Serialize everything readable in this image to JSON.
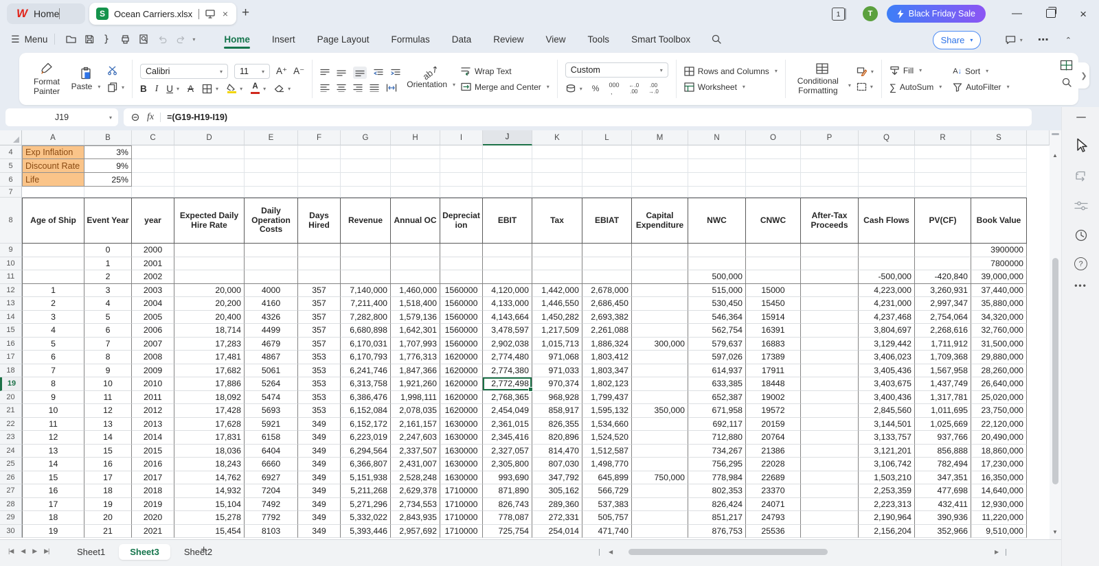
{
  "titlebar": {
    "home_tab": "Home",
    "doc_tab": "Ocean Carriers.xlsx",
    "window_count": "1",
    "avatar": "T",
    "promo": "Black Friday Sale"
  },
  "menubar": {
    "menu": "Menu",
    "tabs": [
      "Home",
      "Insert",
      "Page Layout",
      "Formulas",
      "Data",
      "Review",
      "View",
      "Tools",
      "Smart Toolbox"
    ],
    "active_tab": "Home",
    "share": "Share"
  },
  "ribbon": {
    "format_painter": "Format Painter",
    "paste": "Paste",
    "font_name": "Calibri",
    "font_size": "11",
    "wrap_text": "Wrap Text",
    "merge_center": "Merge and Center",
    "orientation": "Orientation",
    "number_format": "Custom",
    "rows_columns": "Rows and Columns",
    "worksheet": "Worksheet",
    "conditional_formatting": "Conditional Formatting",
    "fill": "Fill",
    "autosum": "AutoSum",
    "sort": "Sort",
    "autofilter": "AutoFilter"
  },
  "formula_bar": {
    "name_box": "J19",
    "fx": "fx",
    "formula": "=(G19-H19-I19)"
  },
  "grid": {
    "columns": [
      "A",
      "B",
      "C",
      "D",
      "E",
      "F",
      "G",
      "H",
      "I",
      "J",
      "K",
      "L",
      "M",
      "N",
      "O",
      "P",
      "Q",
      "R",
      "S"
    ],
    "selected_column": "J",
    "selected_row": "19",
    "selected_cell": "J19",
    "accent_green": "#1C7147",
    "rows": [
      {
        "n": "4",
        "cells": [
          "Exp Inflation",
          "3%",
          "",
          "",
          "",
          "",
          "",
          "",
          "",
          "",
          "",
          "",
          "",
          "",
          "",
          "",
          "",
          "",
          ""
        ]
      },
      {
        "n": "5",
        "cells": [
          "Discount Rate",
          "9%",
          "",
          "",
          "",
          "",
          "",
          "",
          "",
          "",
          "",
          "",
          "",
          "",
          "",
          "",
          "",
          "",
          ""
        ]
      },
      {
        "n": "6",
        "cells": [
          "Life",
          "25%",
          "",
          "",
          "",
          "",
          "",
          "",
          "",
          "",
          "",
          "",
          "",
          "",
          "",
          "",
          "",
          "",
          ""
        ]
      },
      {
        "n": "7",
        "cells": [
          "",
          "",
          "",
          "",
          "",
          "",
          "",
          "",
          "",
          "",
          "",
          "",
          "",
          "",
          "",
          "",
          "",
          "",
          ""
        ]
      },
      {
        "n": "8",
        "cells": [
          "Age of Ship",
          "Event Year",
          "year",
          "Expected Daily Hire Rate",
          "Daily Operation Costs",
          "Days Hired",
          "Revenue",
          "Annual OC",
          "Depreciation",
          "EBIT",
          "Tax",
          "EBIAT",
          "Capital Expenditure",
          "NWC",
          "CNWC",
          "After-Tax Proceeds",
          "Cash Flows",
          "PV(CF)",
          "Book Value"
        ]
      },
      {
        "n": "9",
        "cells": [
          "",
          "0",
          "2000",
          "",
          "",
          "",
          "",
          "",
          "",
          "",
          "",
          "",
          "",
          "",
          "",
          "",
          "",
          "",
          "3900000"
        ]
      },
      {
        "n": "10",
        "cells": [
          "",
          "1",
          "2001",
          "",
          "",
          "",
          "",
          "",
          "",
          "",
          "",
          "",
          "",
          "",
          "",
          "",
          "",
          "",
          "7800000"
        ]
      },
      {
        "n": "11",
        "cells": [
          "",
          "2",
          "2002",
          "",
          "",
          "",
          "",
          "",
          "",
          "",
          "",
          "",
          "",
          "500,000",
          "",
          "",
          "-500,000",
          "-420,840",
          "39,000,000"
        ]
      },
      {
        "n": "12",
        "cells": [
          "1",
          "3",
          "2003",
          "20,000",
          "4000",
          "357",
          "7,140,000",
          "1,460,000",
          "1560000",
          "4,120,000",
          "1,442,000",
          "2,678,000",
          "",
          "515,000",
          "15000",
          "",
          "4,223,000",
          "3,260,931",
          "37,440,000"
        ]
      },
      {
        "n": "13",
        "cells": [
          "2",
          "4",
          "2004",
          "20,200",
          "4160",
          "357",
          "7,211,400",
          "1,518,400",
          "1560000",
          "4,133,000",
          "1,446,550",
          "2,686,450",
          "",
          "530,450",
          "15450",
          "",
          "4,231,000",
          "2,997,347",
          "35,880,000"
        ]
      },
      {
        "n": "14",
        "cells": [
          "3",
          "5",
          "2005",
          "20,400",
          "4326",
          "357",
          "7,282,800",
          "1,579,136",
          "1560000",
          "4,143,664",
          "1,450,282",
          "2,693,382",
          "",
          "546,364",
          "15914",
          "",
          "4,237,468",
          "2,754,064",
          "34,320,000"
        ]
      },
      {
        "n": "15",
        "cells": [
          "4",
          "6",
          "2006",
          "18,714",
          "4499",
          "357",
          "6,680,898",
          "1,642,301",
          "1560000",
          "3,478,597",
          "1,217,509",
          "2,261,088",
          "",
          "562,754",
          "16391",
          "",
          "3,804,697",
          "2,268,616",
          "32,760,000"
        ]
      },
      {
        "n": "16",
        "cells": [
          "5",
          "7",
          "2007",
          "17,283",
          "4679",
          "357",
          "6,170,031",
          "1,707,993",
          "1560000",
          "2,902,038",
          "1,015,713",
          "1,886,324",
          "300,000",
          "579,637",
          "16883",
          "",
          "3,129,442",
          "1,711,912",
          "31,500,000"
        ]
      },
      {
        "n": "17",
        "cells": [
          "6",
          "8",
          "2008",
          "17,481",
          "4867",
          "353",
          "6,170,793",
          "1,776,313",
          "1620000",
          "2,774,480",
          "971,068",
          "1,803,412",
          "",
          "597,026",
          "17389",
          "",
          "3,406,023",
          "1,709,368",
          "29,880,000"
        ]
      },
      {
        "n": "18",
        "cells": [
          "7",
          "9",
          "2009",
          "17,682",
          "5061",
          "353",
          "6,241,746",
          "1,847,366",
          "1620000",
          "2,774,380",
          "971,033",
          "1,803,347",
          "",
          "614,937",
          "17911",
          "",
          "3,405,436",
          "1,567,958",
          "28,260,000"
        ]
      },
      {
        "n": "19",
        "cells": [
          "8",
          "10",
          "2010",
          "17,886",
          "5264",
          "353",
          "6,313,758",
          "1,921,260",
          "1620000",
          "2,772,498",
          "970,374",
          "1,802,123",
          "",
          "633,385",
          "18448",
          "",
          "3,403,675",
          "1,437,749",
          "26,640,000"
        ]
      },
      {
        "n": "20",
        "cells": [
          "9",
          "11",
          "2011",
          "18,092",
          "5474",
          "353",
          "6,386,476",
          "1,998,111",
          "1620000",
          "2,768,365",
          "968,928",
          "1,799,437",
          "",
          "652,387",
          "19002",
          "",
          "3,400,436",
          "1,317,781",
          "25,020,000"
        ]
      },
      {
        "n": "21",
        "cells": [
          "10",
          "12",
          "2012",
          "17,428",
          "5693",
          "353",
          "6,152,084",
          "2,078,035",
          "1620000",
          "2,454,049",
          "858,917",
          "1,595,132",
          "350,000",
          "671,958",
          "19572",
          "",
          "2,845,560",
          "1,011,695",
          "23,750,000"
        ]
      },
      {
        "n": "22",
        "cells": [
          "11",
          "13",
          "2013",
          "17,628",
          "5921",
          "349",
          "6,152,172",
          "2,161,157",
          "1630000",
          "2,361,015",
          "826,355",
          "1,534,660",
          "",
          "692,117",
          "20159",
          "",
          "3,144,501",
          "1,025,669",
          "22,120,000"
        ]
      },
      {
        "n": "23",
        "cells": [
          "12",
          "14",
          "2014",
          "17,831",
          "6158",
          "349",
          "6,223,019",
          "2,247,603",
          "1630000",
          "2,345,416",
          "820,896",
          "1,524,520",
          "",
          "712,880",
          "20764",
          "",
          "3,133,757",
          "937,766",
          "20,490,000"
        ]
      },
      {
        "n": "24",
        "cells": [
          "13",
          "15",
          "2015",
          "18,036",
          "6404",
          "349",
          "6,294,564",
          "2,337,507",
          "1630000",
          "2,327,057",
          "814,470",
          "1,512,587",
          "",
          "734,267",
          "21386",
          "",
          "3,121,201",
          "856,888",
          "18,860,000"
        ]
      },
      {
        "n": "25",
        "cells": [
          "14",
          "16",
          "2016",
          "18,243",
          "6660",
          "349",
          "6,366,807",
          "2,431,007",
          "1630000",
          "2,305,800",
          "807,030",
          "1,498,770",
          "",
          "756,295",
          "22028",
          "",
          "3,106,742",
          "782,494",
          "17,230,000"
        ]
      },
      {
        "n": "26",
        "cells": [
          "15",
          "17",
          "2017",
          "14,762",
          "6927",
          "349",
          "5,151,938",
          "2,528,248",
          "1630000",
          "993,690",
          "347,792",
          "645,899",
          "750,000",
          "778,984",
          "22689",
          "",
          "1,503,210",
          "347,351",
          "16,350,000"
        ]
      },
      {
        "n": "27",
        "cells": [
          "16",
          "18",
          "2018",
          "14,932",
          "7204",
          "349",
          "5,211,268",
          "2,629,378",
          "1710000",
          "871,890",
          "305,162",
          "566,729",
          "",
          "802,353",
          "23370",
          "",
          "2,253,359",
          "477,698",
          "14,640,000"
        ]
      },
      {
        "n": "28",
        "cells": [
          "17",
          "19",
          "2019",
          "15,104",
          "7492",
          "349",
          "5,271,296",
          "2,734,553",
          "1710000",
          "826,743",
          "289,360",
          "537,383",
          "",
          "826,424",
          "24071",
          "",
          "2,223,313",
          "432,411",
          "12,930,000"
        ]
      },
      {
        "n": "29",
        "cells": [
          "18",
          "20",
          "2020",
          "15,278",
          "7792",
          "349",
          "5,332,022",
          "2,843,935",
          "1710000",
          "778,087",
          "272,331",
          "505,757",
          "",
          "851,217",
          "24793",
          "",
          "2,190,964",
          "390,936",
          "11,220,000"
        ]
      },
      {
        "n": "30",
        "cells": [
          "19",
          "21",
          "2021",
          "15,454",
          "8103",
          "349",
          "5,393,446",
          "2,957,692",
          "1710000",
          "725,754",
          "254,014",
          "471,740",
          "",
          "876,753",
          "25536",
          "",
          "2,156,204",
          "352,966",
          "9,510,000"
        ]
      }
    ]
  },
  "sheetbar": {
    "sheets": [
      "Sheet1",
      "Sheet3",
      "Sheet2"
    ],
    "active_sheet": "Sheet3"
  }
}
